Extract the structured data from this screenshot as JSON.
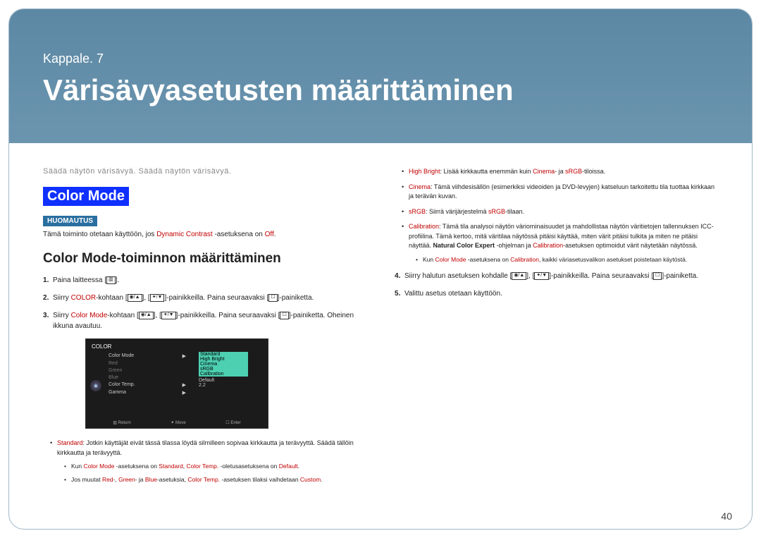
{
  "header": {
    "chapter_label": "Kappale. 7",
    "title": "Värisävyasetusten määrittäminen"
  },
  "intro_subtitle": "Säädä näytön värisävyä. Säädä näytön värisävyä.",
  "section_badge": "Color Mode",
  "note_badge": "HUOMAUTUS",
  "note_text_pre": "Tämä toiminto otetaan käyttöön, jos ",
  "note_dc": "Dynamic Contrast",
  "note_text_mid": " -asetuksena on ",
  "note_off": "Off",
  "note_text_post": ".",
  "subheading": "Color Mode-toiminnon määrittäminen",
  "steps": {
    "s1": "Paina laitteessa [",
    "s1_icon": "▥",
    "s1_end": "].",
    "s2_a": "Siirry ",
    "s2_color": "COLOR",
    "s2_b": "-kohtaan [",
    "s2_icon1": "◉/▲",
    "s2_c": "], [",
    "s2_icon2": "✦/▼",
    "s2_d": "]-painikkeilla. Paina seuraavaksi [",
    "s2_icon3": "☐",
    "s2_e": "]-painiketta.",
    "s3_a": "Siirry ",
    "s3_cm": "Color Mode",
    "s3_b": "-kohtaan [",
    "s3_icon1": "◉/▲",
    "s3_c": "], [",
    "s3_icon2": "✦/▼",
    "s3_d": "]-painikkeilla. Paina seuraavaksi [",
    "s3_icon3": "☐",
    "s3_e": "]-painiketta. Oheinen ikkuna avautuu."
  },
  "osd": {
    "title": "COLOR",
    "rows": [
      "Color Mode",
      "Red",
      "Green",
      "Blue",
      "Color Temp.",
      "Gamma"
    ],
    "values_sel": "Standard",
    "opts": [
      "High Bright",
      "Cinema",
      "sRGB",
      "Calibration"
    ],
    "val_temp": "Default",
    "val_gamma": "2.2",
    "bottom": [
      "▥ Return",
      "✦ Move",
      "☐ Enter"
    ]
  },
  "left_bullets": {
    "b1_key": "Standard",
    "b1_txt": ": Jotkin käyttäjät eivät tässä tilassa löydä silmilleen sopivaa kirkkautta ja terävyyttä. Säädä tällöin kirkkautta ja terävyyttä.",
    "b1s1_a": "Kun ",
    "b1s1_cm": "Color Mode",
    "b1s1_b": " -asetuksena on ",
    "b1s1_std": "Standard",
    "b1s1_c": ", ",
    "b1s1_ct": "Color Temp.",
    "b1s1_d": " -oletusasetuksena on ",
    "b1s1_def": "Default",
    "b1s1_e": ".",
    "b1s2_a": "Jos muutat ",
    "b1s2_r": "Red",
    "b1s2_b": "-, ",
    "b1s2_g": "Green",
    "b1s2_c": "- ja ",
    "b1s2_bl": "Blue",
    "b1s2_d": "-asetuksia, ",
    "b1s2_ct": "Color Temp.",
    "b1s2_e": " -asetuksen tilaksi vaihdetaan ",
    "b1s2_cu": "Custom",
    "b1s2_f": "."
  },
  "right_bullets": {
    "r1_key": "High Bright",
    "r1_txt_a": ": Lisää kirkkautta enemmän kuin ",
    "r1_cin": "Cinema",
    "r1_txt_b": "- ja ",
    "r1_srgb": "sRGB",
    "r1_txt_c": "-tiloissa.",
    "r2_key": "Cinema",
    "r2_txt": ": Tämä viihdesisällön (esimerkiksi videoiden ja DVD-levyjen) katseluun tarkoitettu tila tuottaa kirkkaan ja terävän kuvan.",
    "r3_key": "sRGB",
    "r3_txt_a": ": Siirrä värijärjestelmä ",
    "r3_srgb": "sRGB",
    "r3_txt_b": "-tilaan.",
    "r4_key": "Calibration",
    "r4_txt_a": ": Tämä tila analysoi näytön väriominaisuudet ja mahdollistaa näytön väritietojen tallennuksen ICC-profiilina. Tämä kertoo, mitä väritilaa näytössä pitäisi käyttää, miten värit pitäisi tulkita ja miten ne pitäisi näyttää. ",
    "r4_nce": "Natural Color Expert",
    "r4_txt_b": " -ohjelman ja ",
    "r4_cal": "Calibration",
    "r4_txt_c": "-asetuksen optimoidut värit näytetään näytössä.",
    "r4s_a": "Kun ",
    "r4s_cm": "Color Mode",
    "r4s_b": " -asetuksena on ",
    "r4s_cal": "Calibration",
    "r4s_c": ", kaikki väriasetusvalikon asetukset poistetaan käytöstä."
  },
  "steps_right": {
    "s4_a": "Siirry halutun asetuksen kohdalle [",
    "s4_i1": "◉/▲",
    "s4_b": "], [",
    "s4_i2": "✦/▼",
    "s4_c": "]-painikkeilla. Paina seuraavaksi [",
    "s4_i3": "☐",
    "s4_d": "]-painiketta.",
    "s5": "Valittu asetus otetaan käyttöön."
  },
  "page_number": "40"
}
